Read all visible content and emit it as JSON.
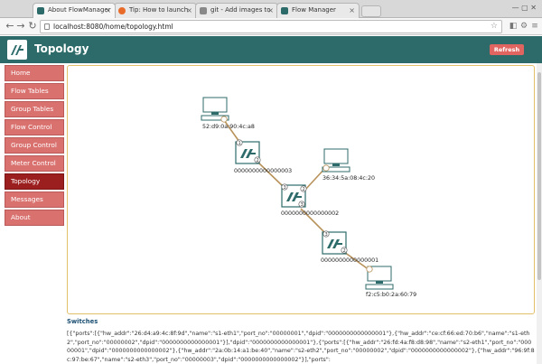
{
  "browser": {
    "tabs": [
      {
        "title": "About FlowManager",
        "active": true
      },
      {
        "title": "Tip: How to launch",
        "active": false
      },
      {
        "title": "git - Add images to",
        "active": false
      },
      {
        "title": "Flow Manager",
        "active": false
      }
    ],
    "url": "localhost:8080/home/topology.html"
  },
  "header": {
    "title": "Topology",
    "refresh_label": "Refresh"
  },
  "sidebar": {
    "items": [
      {
        "label": "Home",
        "active": false
      },
      {
        "label": "Flow Tables",
        "active": false
      },
      {
        "label": "Group Tables",
        "active": false
      },
      {
        "label": "Flow Control",
        "active": false
      },
      {
        "label": "Group Control",
        "active": false
      },
      {
        "label": "Meter Control",
        "active": false
      },
      {
        "label": "Topology",
        "active": true
      },
      {
        "label": "Messages",
        "active": false
      },
      {
        "label": "About",
        "active": false
      }
    ]
  },
  "topology": {
    "hosts": [
      {
        "label": "52:d9:0a:90:4c:a8"
      },
      {
        "label": "36:34:5a:08:4c:20"
      },
      {
        "label": "f2:c5:b0:2a:60:79"
      }
    ],
    "switches": [
      {
        "label": "0000000000000003"
      },
      {
        "label": "0000000000000002"
      },
      {
        "label": "0000000000000001"
      }
    ],
    "ports": [
      "1",
      "2",
      "3",
      "2",
      "3",
      "1",
      "3",
      "2",
      "1"
    ]
  },
  "switches_section": {
    "title": "Switches",
    "json": "[{\"ports\":[{\"hw_addr\":\"26:d4:a9:4c:8f:9d\",\"name\":\"s1-eth1\",\"port_no\":\"00000001\",\"dpid\":\"0000000000000001\"},{\"hw_addr\":\"ce:cf:66:ed:70:b6\",\"name\":\"s1-eth2\",\"port_no\":\"00000002\",\"dpid\":\"0000000000000001\"}],\"dpid\":\"0000000000000001\"},{\"ports\":[{\"hw_addr\":\"26:fd:4a:f8:d8:98\",\"name\":\"s2-eth1\",\"port_no\":\"00000001\",\"dpid\":\"0000000000000002\"},{\"hw_addr\":\"2a:0b:14:a1:be:40\",\"name\":\"s2-eth2\",\"port_no\":\"00000002\",\"dpid\":\"0000000000000002\"},{\"hw_addr\":\"96:9f:8c:97:be:67\",\"name\":\"s2-eth3\",\"port_no\":\"00000003\",\"dpid\":\"0000000000000002\"}],\"ports\":"
  },
  "colors": {
    "header_bg": "#2c6b6a",
    "nav_bg": "#d9716f",
    "nav_active_bg": "#9c1f1f",
    "refresh_bg": "#e0645f",
    "link_color": "#b8925a"
  }
}
